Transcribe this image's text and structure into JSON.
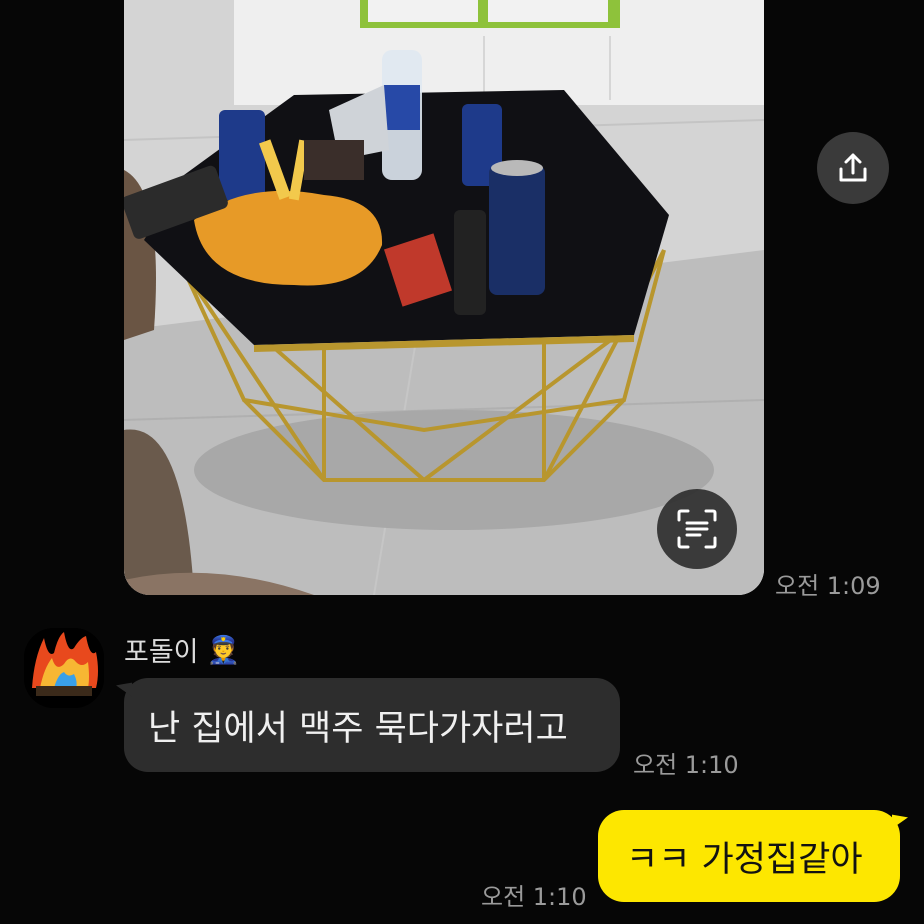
{
  "messages": {
    "photo": {
      "time": "오전 1:09"
    },
    "incoming": {
      "sender": "포돌이",
      "sender_emoji": "👮",
      "text": "난 집에서 맥주 묵다가자러고",
      "time": "오전 1:10"
    },
    "outgoing": {
      "text": "ㅋㅋ 가정집같아",
      "time": "오전 1:10"
    }
  },
  "icons": {
    "share": "share-icon",
    "scan": "text-scan-icon"
  },
  "colors": {
    "background": "#060606",
    "incoming_bubble": "#2d2d2d",
    "outgoing_bubble": "#fde700",
    "time_text": "#9a9a9a"
  }
}
